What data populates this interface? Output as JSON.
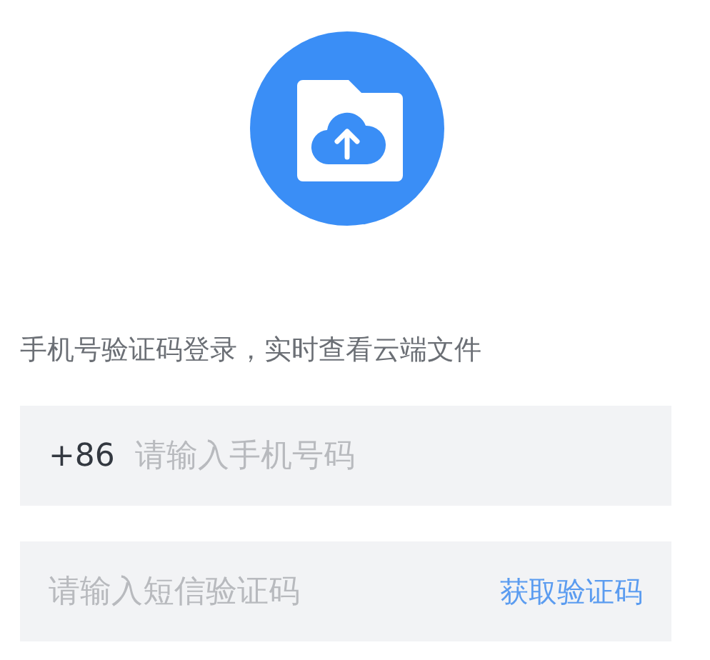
{
  "hint": "手机号验证码登录，实时查看云端文件",
  "phone": {
    "prefix": "+86",
    "placeholder": "请输入手机号码"
  },
  "code": {
    "placeholder": "请输入短信验证码",
    "action": "获取验证码"
  }
}
